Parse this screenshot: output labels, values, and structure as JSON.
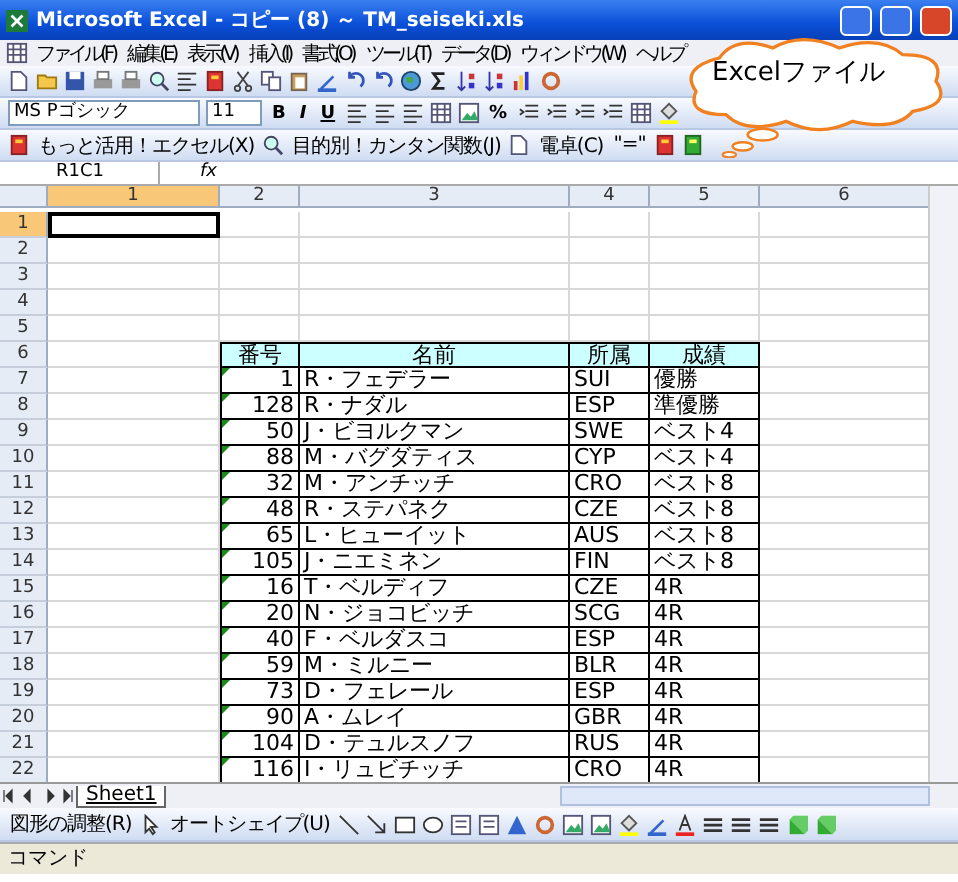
{
  "window": {
    "title": "Microsoft Excel - コピー (8) ～ TM_seiseki.xls"
  },
  "menu": [
    "ファイル(F)",
    "編集(E)",
    "表示(V)",
    "挿入(I)",
    "書式(O)",
    "ツール(T)",
    "データ(D)",
    "ウィンドウ(W)",
    "ヘルプ"
  ],
  "format_toolbar": {
    "font": "MS Pゴシック",
    "size": "11",
    "bold": "B",
    "italic": "I",
    "underline": "U",
    "percent": "%"
  },
  "addin_toolbar": [
    "もっと活用！エクセル(X)",
    "目的別！カンタン関数(J)",
    "電卓(C)",
    "\"=\""
  ],
  "formula_bar": {
    "name_box": "R1C1",
    "fx": "fx"
  },
  "callout": {
    "text": "Excelファイル"
  },
  "column_headers": [
    {
      "label": "1",
      "selected": true
    },
    {
      "label": "2",
      "selected": false
    },
    {
      "label": "3",
      "selected": false
    },
    {
      "label": "4",
      "selected": false
    },
    {
      "label": "5",
      "selected": false
    },
    {
      "label": "6",
      "selected": false
    }
  ],
  "row_headers": [
    {
      "label": "1",
      "selected": true
    },
    {
      "label": "2",
      "selected": false
    },
    {
      "label": "3",
      "selected": false
    },
    {
      "label": "4",
      "selected": false
    },
    {
      "label": "5",
      "selected": false
    },
    {
      "label": "6",
      "selected": false
    },
    {
      "label": "7",
      "selected": false
    },
    {
      "label": "8",
      "selected": false
    },
    {
      "label": "9",
      "selected": false
    },
    {
      "label": "10",
      "selected": false
    },
    {
      "label": "11",
      "selected": false
    },
    {
      "label": "12",
      "selected": false
    },
    {
      "label": "13",
      "selected": false
    },
    {
      "label": "14",
      "selected": false
    },
    {
      "label": "15",
      "selected": false
    },
    {
      "label": "16",
      "selected": false
    },
    {
      "label": "17",
      "selected": false
    },
    {
      "label": "18",
      "selected": false
    },
    {
      "label": "19",
      "selected": false
    },
    {
      "label": "20",
      "selected": false
    },
    {
      "label": "21",
      "selected": false
    },
    {
      "label": "22",
      "selected": false
    }
  ],
  "table": {
    "columns": [
      "番号",
      "名前",
      "所属",
      "成績"
    ],
    "rows": [
      [
        "1",
        "R・フェデラー",
        "SUI",
        "優勝"
      ],
      [
        "128",
        "R・ナダル",
        "ESP",
        "準優勝"
      ],
      [
        "50",
        "J・ビヨルクマン",
        "SWE",
        "ベスト4"
      ],
      [
        "88",
        "M・バグダティス",
        "CYP",
        "ベスト4"
      ],
      [
        "32",
        "M・アンチッチ",
        "CRO",
        "ベスト8"
      ],
      [
        "48",
        "R・ステパネク",
        "CZE",
        "ベスト8"
      ],
      [
        "65",
        "L・ヒューイット",
        "AUS",
        "ベスト8"
      ],
      [
        "105",
        "J・ニエミネン",
        "FIN",
        "ベスト8"
      ],
      [
        "16",
        "T・ベルディフ",
        "CZE",
        "4R"
      ],
      [
        "20",
        "N・ジョコビッチ",
        "SCG",
        "4R"
      ],
      [
        "40",
        "F・ベルダスコ",
        "ESP",
        "4R"
      ],
      [
        "59",
        "M・ミルニー",
        "BLR",
        "4R"
      ],
      [
        "73",
        "D・フェレール",
        "ESP",
        "4R"
      ],
      [
        "90",
        "A・ムレイ",
        "GBR",
        "4R"
      ],
      [
        "104",
        "D・テュルスノフ",
        "RUS",
        "4R"
      ],
      [
        "116",
        "I・リュビチッチ",
        "CRO",
        "4R"
      ]
    ]
  },
  "sheet_tabs": [
    {
      "label": "Sheet1",
      "selected": true
    }
  ],
  "drawing_toolbar": [
    "図形の調整(R)",
    "オートシェイプ(U)"
  ],
  "status_bar": "コマンド"
}
